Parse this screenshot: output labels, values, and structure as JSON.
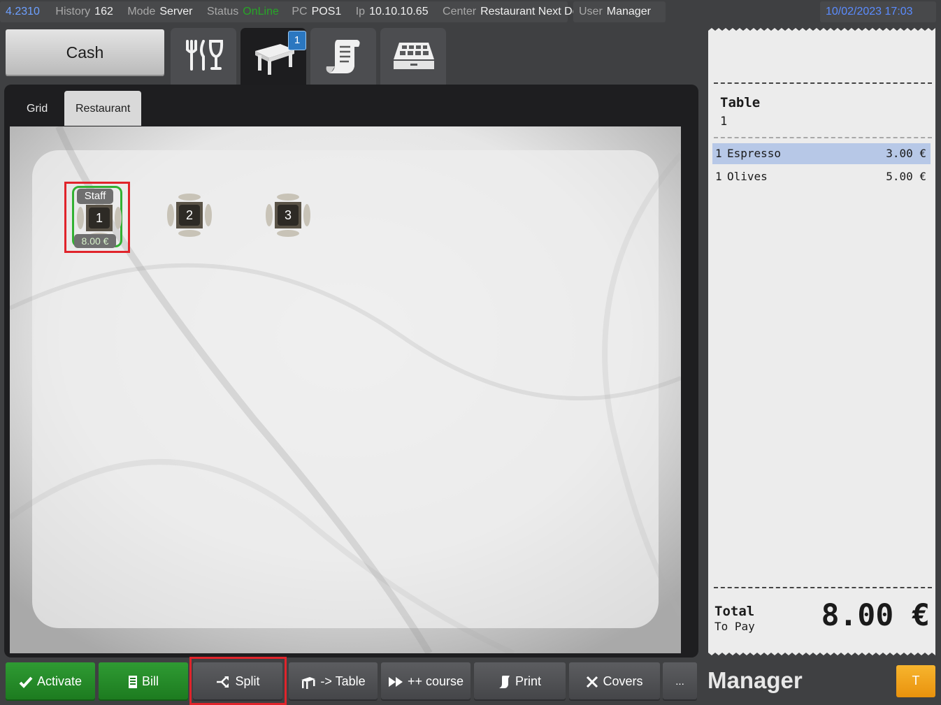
{
  "status_bar": {
    "version": "4.2310",
    "history_label": "History",
    "history_value": "162",
    "mode_label": "Mode",
    "mode_value": "Server",
    "status_label": "Status",
    "status_value": "OnLine",
    "pc_label": "PC",
    "pc_value": "POS1",
    "ip_label": "Ip",
    "ip_value": "10.10.10.65",
    "center_label": "Center",
    "center_value": "Restaurant Next Door",
    "user_label": "User",
    "user_value": "Manager",
    "datetime": "10/02/2023 17:03"
  },
  "top": {
    "cash_label": "Cash",
    "mode_tabs": [
      {
        "icon": "cutlery-glass-icon"
      },
      {
        "icon": "table-icon",
        "badge": "1",
        "active": true
      },
      {
        "icon": "receipt-scroll-icon"
      },
      {
        "icon": "cash-register-icon"
      }
    ]
  },
  "view_tabs": [
    {
      "label": "Grid",
      "active": false
    },
    {
      "label": "Restaurant",
      "active": true
    }
  ],
  "floor": {
    "tables": [
      {
        "number": "1",
        "tag": "Staff",
        "amount": "8.00 €",
        "selected": true
      },
      {
        "number": "2"
      },
      {
        "number": "3"
      }
    ]
  },
  "receipt": {
    "title": "Table",
    "table_number": "1",
    "items": [
      {
        "qty": "1",
        "name": "Espresso",
        "price": "3.00 €",
        "highlighted": true
      },
      {
        "qty": "1",
        "name": "Olives",
        "price": "5.00 €",
        "highlighted": false
      }
    ],
    "total_label": "Total",
    "to_pay_label": "To Pay",
    "total_value": "8.00 €"
  },
  "user_display": "Manager",
  "t_button": "T",
  "actions": {
    "activate": "Activate",
    "bill": "Bill",
    "split": "Split",
    "to_table": "-> Table",
    "course": "++ course",
    "print": "Print",
    "covers": "Covers",
    "more": "..."
  },
  "colors": {
    "accent_green": "#2f9b33",
    "highlight_red": "#e0242b",
    "badge_blue": "#2b77c0",
    "t_orange": "#f0a21d"
  }
}
